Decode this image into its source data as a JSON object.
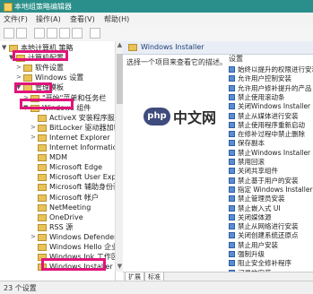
{
  "window": {
    "title": "本地组策略编辑器"
  },
  "menu": [
    "文件(F)",
    "操作(A)",
    "查看(V)",
    "帮助(H)"
  ],
  "tree": [
    {
      "label": "本地计算机 策略",
      "level": 0,
      "twisty": "▼"
    },
    {
      "label": "计算机配置",
      "level": 1,
      "twisty": "▼"
    },
    {
      "label": "软件设置",
      "level": 2,
      "twisty": ">"
    },
    {
      "label": "Windows 设置",
      "level": 2,
      "twisty": ">"
    },
    {
      "label": "管理模板",
      "level": 2,
      "twisty": "▼"
    },
    {
      "label": "\"开始\"菜单和任务栏",
      "level": 3,
      "twisty": ">"
    },
    {
      "label": "Windows 组件",
      "level": 3,
      "twisty": "▼"
    },
    {
      "label": "ActiveX 安装程序服务",
      "level": 4,
      "twisty": ""
    },
    {
      "label": "BitLocker 驱动器加密",
      "level": 4,
      "twisty": ">"
    },
    {
      "label": "Internet Explorer",
      "level": 4,
      "twisty": ">"
    },
    {
      "label": "Internet Information",
      "level": 4,
      "twisty": ""
    },
    {
      "label": "MDM",
      "level": 4,
      "twisty": ""
    },
    {
      "label": "Microsoft Edge",
      "level": 4,
      "twisty": ""
    },
    {
      "label": "Microsoft User Expe",
      "level": 4,
      "twisty": ""
    },
    {
      "label": "Microsoft 辅助身份验",
      "level": 4,
      "twisty": ""
    },
    {
      "label": "Microsoft 帐户",
      "level": 4,
      "twisty": ""
    },
    {
      "label": "NetMeeting",
      "level": 4,
      "twisty": ""
    },
    {
      "label": "OneDrive",
      "level": 4,
      "twisty": ""
    },
    {
      "label": "RSS 源",
      "level": 4,
      "twisty": ""
    },
    {
      "label": "Windows Defender",
      "level": 4,
      "twisty": ">"
    },
    {
      "label": "Windows Hello 企业",
      "level": 4,
      "twisty": ""
    },
    {
      "label": "Windows Ink 工作区",
      "level": 4,
      "twisty": ""
    },
    {
      "label": "Windows Installer",
      "level": 4,
      "twisty": ""
    }
  ],
  "right": {
    "header": "Windows Installer",
    "description": "选择一个项目来查看它的描述。",
    "column": "设置",
    "settings": [
      "始终以提升的权限进行安装",
      "允许用户控制安装",
      "允许用户修补提升的产品",
      "禁止使用滚动条",
      "关闭Windows Installer",
      "禁止从媒体进行安装",
      "禁止使用程序重新启动",
      "在修补过程中禁止删除",
      "保存副本",
      "禁止Windows Installer",
      "禁用回滚",
      "关闭共享组件",
      "禁止基于用户的安装",
      "指定 Windows Installer",
      "禁止管理员安装",
      "禁止嵌入式 UI",
      "关闭媒体源",
      "禁止从网络进行安装",
      "关闭创建系统还原点",
      "禁止用户安装",
      "强制升级",
      "阻止安全修补程序",
      "记录的安装"
    ]
  },
  "tabs": [
    "扩展",
    "标准"
  ],
  "status": "23 个设置",
  "watermark": {
    "badge": "php",
    "text": "中文网"
  }
}
